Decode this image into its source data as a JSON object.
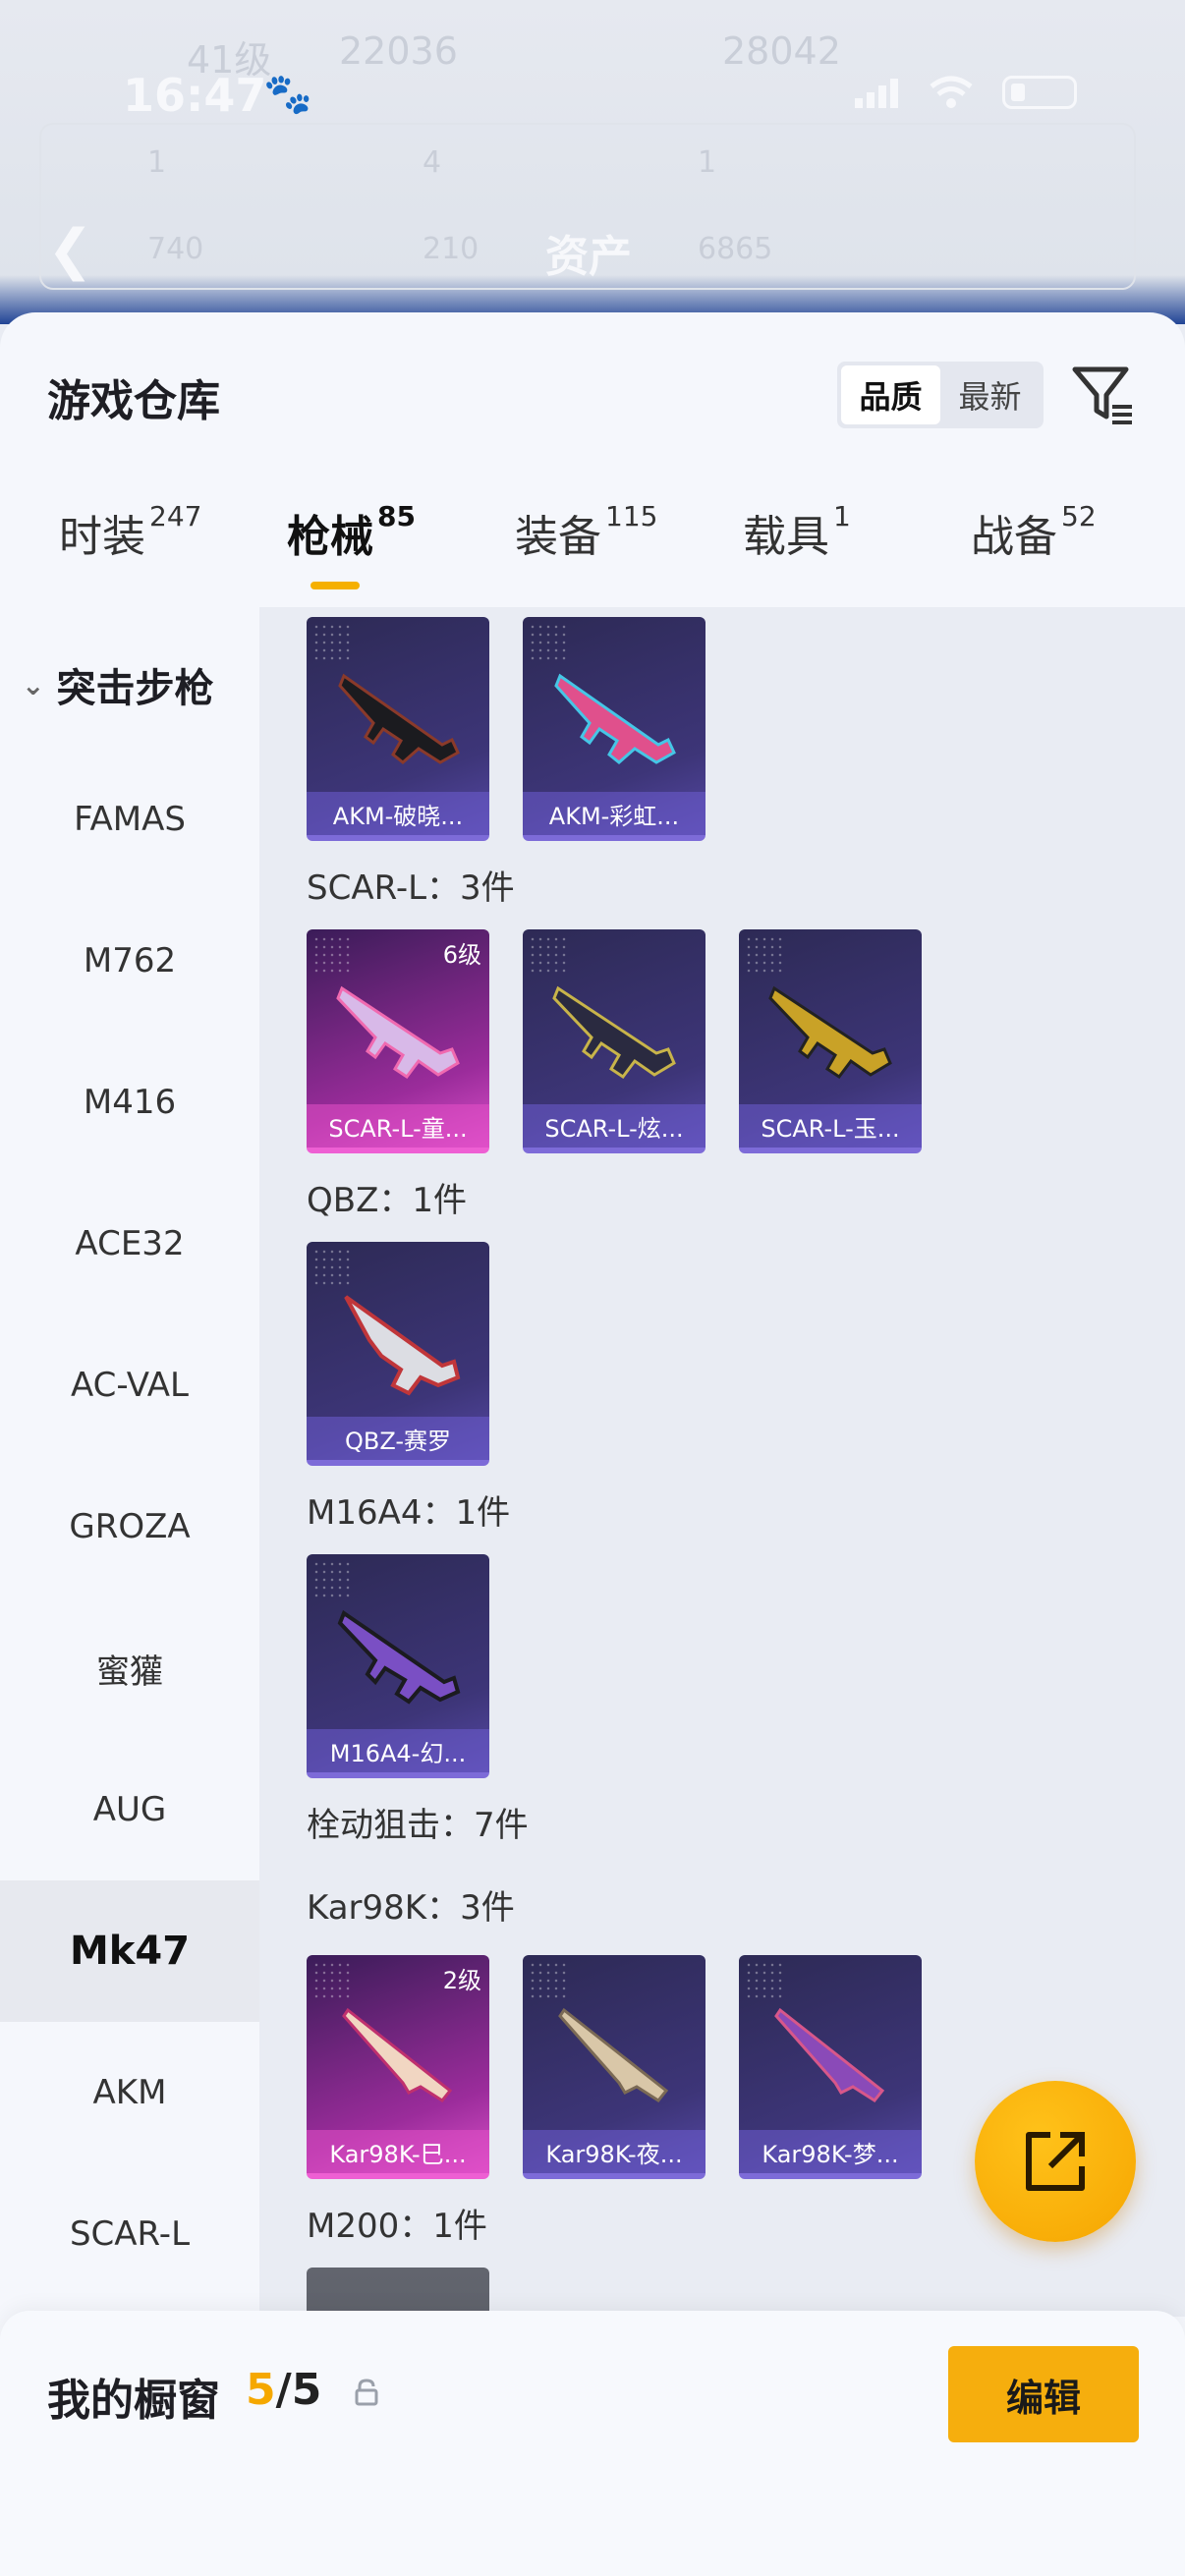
{
  "status_bar": {
    "time": "16:47"
  },
  "header_ghost": {
    "level": "41级",
    "stat_a": "22036",
    "stat_b": "28042",
    "row2": [
      "1",
      "4",
      "1"
    ],
    "row3": [
      "740",
      "210"
    ],
    "title": "资产",
    "row3_right": "6865"
  },
  "warehouse": {
    "title": "游戏仓库",
    "sort_options": [
      "品质",
      "最新"
    ],
    "sort_active": "品质",
    "tabs": [
      {
        "label": "时装",
        "count": "247"
      },
      {
        "label": "枪械",
        "count": "85"
      },
      {
        "label": "装备",
        "count": "115"
      },
      {
        "label": "载具",
        "count": "1"
      },
      {
        "label": "战备",
        "count": "52"
      }
    ]
  },
  "sidebar": {
    "group": "突击步枪",
    "items": [
      "FAMAS",
      "M762",
      "M416",
      "ACE32",
      "AC-VAL",
      "GROZA",
      "蜜獾",
      "AUG",
      "Mk47",
      "AKM",
      "SCAR-L"
    ],
    "active": "Mk47"
  },
  "content": {
    "akm_cards": [
      "AKM-破晓...",
      "AKM-彩虹..."
    ],
    "scarl_label": "SCAR-L：3件",
    "scarl_cards": [
      "SCAR-L-童...",
      "SCAR-L-炫...",
      "SCAR-L-玉..."
    ],
    "scarl_level": "6级",
    "qbz_label": "QBZ：1件",
    "qbz_cards": [
      "QBZ-赛罗"
    ],
    "m16_label": "M16A4：1件",
    "m16_cards": [
      "M16A4-幻..."
    ],
    "bolt_label": "栓动狙击：7件",
    "kar_label": "Kar98K：3件",
    "kar_cards": [
      "Kar98K-巳...",
      "Kar98K-夜...",
      "Kar98K-梦..."
    ],
    "kar_level": "2级",
    "m200_label": "M200：1件"
  },
  "bottom": {
    "showcase_label": "我的橱窗",
    "current": "5",
    "total": "/5",
    "edit_label": "编辑"
  },
  "colors": {
    "accent": "#f6ae0d",
    "purple_card": "#3d3578",
    "pink_card": "#9b2c9b"
  }
}
